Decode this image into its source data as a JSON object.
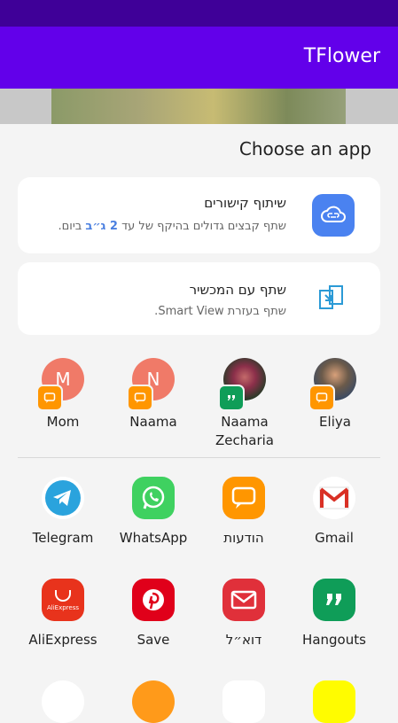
{
  "app_bar": {
    "title": "TFlower",
    "color": "#6200ea"
  },
  "sheet": {
    "title": "Choose an app"
  },
  "share_cards": [
    {
      "title": "שיתוף קישורים",
      "sub_before": "שתף קבצים גדולים בהיקף של עד ",
      "sub_highlight": "2 ג״ב",
      "sub_after": " ביום.",
      "icon": "cloud-link-icon"
    },
    {
      "title": "שתף עם המכשיר",
      "subtitle": "שתף בעזרת Smart View.",
      "icon": "smart-view-icon"
    }
  ],
  "contacts": [
    {
      "name": "Eliya",
      "avatar": "photo",
      "badge": "message-icon"
    },
    {
      "name": "Naama Zecharia",
      "avatar": "photo",
      "badge": "hangouts-icon"
    },
    {
      "name": "Naama",
      "initial": "N",
      "badge": "message-icon"
    },
    {
      "name": "Mom",
      "initial": "M",
      "badge": "message-icon"
    }
  ],
  "apps_row1": [
    {
      "label": "Gmail",
      "icon": "gmail-icon",
      "color": "#ffffff"
    },
    {
      "label": "הודעות",
      "icon": "messages-icon",
      "color": "#ff9600"
    },
    {
      "label": "WhatsApp",
      "icon": "whatsapp-icon",
      "color": "#3fd160"
    },
    {
      "label": "Telegram",
      "icon": "telegram-icon",
      "color": "#2aa3dd"
    }
  ],
  "apps_row2": [
    {
      "label": "Hangouts",
      "icon": "hangouts-icon",
      "color": "#0f9d58"
    },
    {
      "label": "דוא״ל",
      "icon": "email-icon",
      "color": "#e0303a"
    },
    {
      "label": "Save",
      "icon": "pinterest-icon",
      "color": "#e0001a"
    },
    {
      "label": "AliExpress",
      "icon": "aliexpress-icon",
      "color": "#e8331c",
      "badge_text": "AliExpress"
    }
  ]
}
